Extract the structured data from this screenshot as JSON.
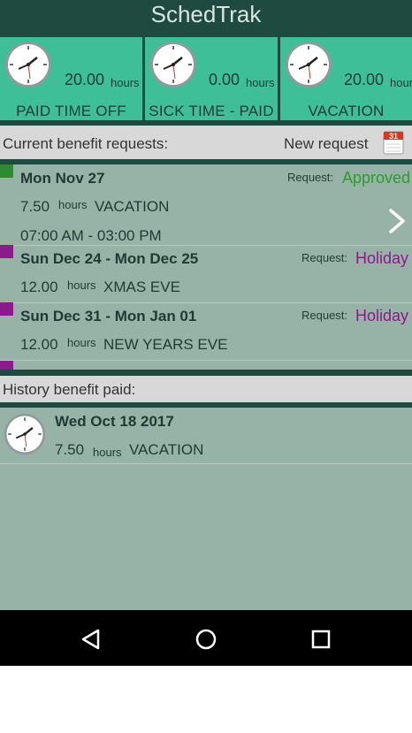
{
  "app": {
    "title": "SchedTrak"
  },
  "balances": [
    {
      "hours": "20.00",
      "unit": "hours",
      "label": "PAID TIME OFF"
    },
    {
      "hours": "0.00",
      "unit": "hours",
      "label": "SICK TIME - PAID"
    },
    {
      "hours": "20.00",
      "unit": "hours",
      "label": "VACATION"
    }
  ],
  "current": {
    "header": "Current benefit requests:",
    "new_request_label": "New request",
    "calendar_day": "31",
    "requests": [
      {
        "date": "Mon Nov 27",
        "request_label": "Request:",
        "status": "Approved",
        "hours": "7.50",
        "unit": "hours",
        "type": "VACATION",
        "time": "07:00 AM - 03:00 PM",
        "marker_color": "#2e8b2e",
        "status_color": "#2e9b2e"
      },
      {
        "date": "Sun Dec 24 - Mon Dec 25",
        "request_label": "Request:",
        "status": "Holiday",
        "hours": "12.00",
        "unit": "hours",
        "type": "XMAS EVE",
        "marker_color": "#8b1a8b",
        "status_color": "#8b1a8b"
      },
      {
        "date": "Sun Dec 31 - Mon Jan 01",
        "request_label": "Request:",
        "status": "Holiday",
        "hours": "12.00",
        "unit": "hours",
        "type": "NEW YEARS EVE",
        "marker_color": "#8b1a8b",
        "status_color": "#8b1a8b"
      }
    ]
  },
  "history": {
    "header": "History benefit paid:",
    "items": [
      {
        "date": "Wed Oct 18 2017",
        "hours": "7.50",
        "unit": "hours",
        "type": "VACATION"
      }
    ]
  },
  "icons": {
    "clock": "clock-icon",
    "calendar": "calendar-icon",
    "chevron": "chevron-right-icon",
    "back": "back-icon",
    "home": "home-icon",
    "recents": "recents-icon"
  },
  "colors": {
    "header_bg": "#1f4a3f",
    "tile_bg": "#3fbf97",
    "content_bg": "#97b3a8",
    "section_bg": "#d8d8d8"
  }
}
